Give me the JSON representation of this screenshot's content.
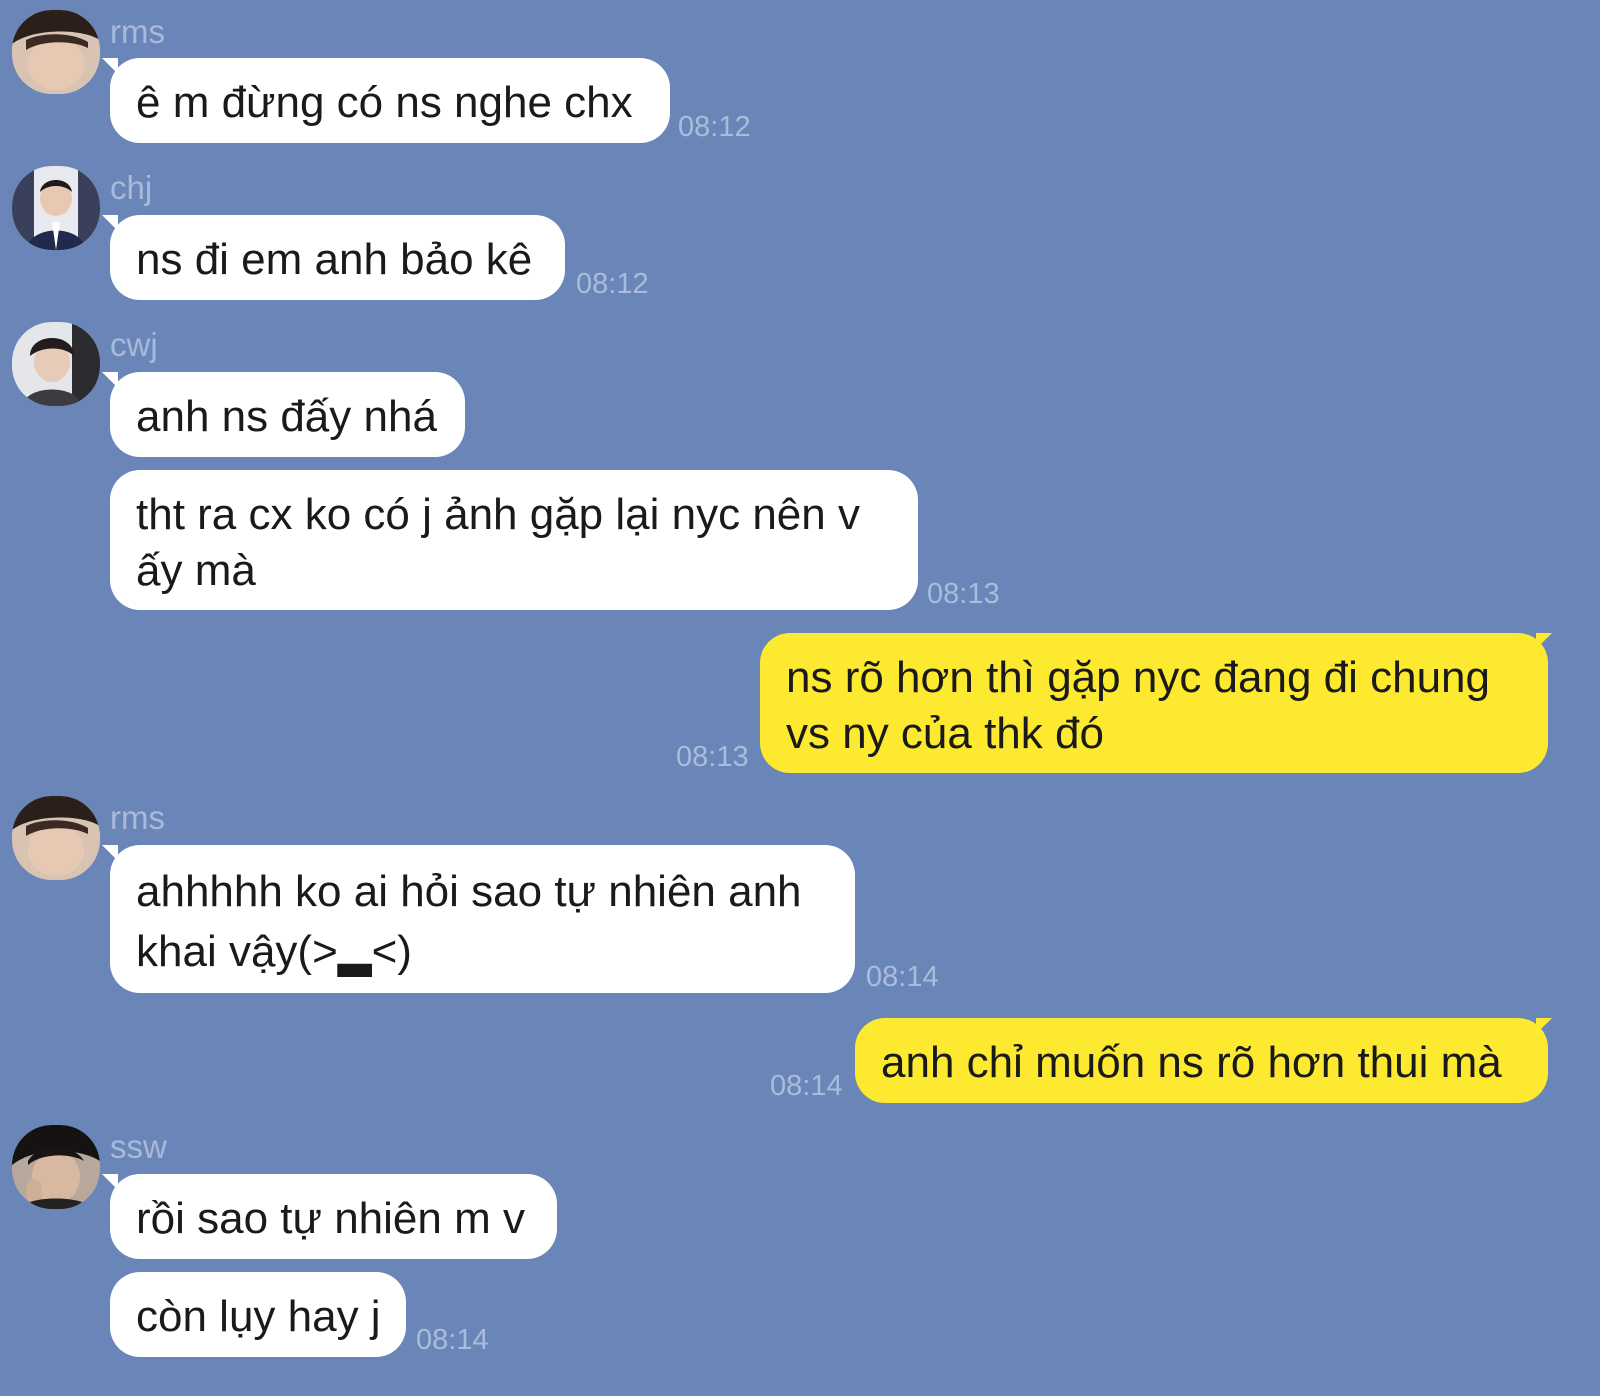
{
  "chat": {
    "messages": [
      {
        "sender": "rms",
        "text": "ê m đừng có ns nghe chx",
        "time": "08:12",
        "direction": "incoming",
        "avatar": "avatar-rms"
      },
      {
        "sender": "chj",
        "text": "ns đi em anh bảo kê",
        "time": "08:12",
        "direction": "incoming",
        "avatar": "avatar-chj"
      },
      {
        "sender": "cwj",
        "text": "anh ns đấy nhá",
        "time": "",
        "direction": "incoming",
        "avatar": "avatar-cwj"
      },
      {
        "sender": "",
        "lines": [
          "tht ra cx ko có j ảnh gặp lại nyc nên v",
          "ấy mà"
        ],
        "time": "08:13",
        "direction": "incoming"
      },
      {
        "sender": "",
        "lines": [
          "ns rõ hơn thì gặp nyc đang đi chung",
          "vs ny của thk đó"
        ],
        "time": "08:13",
        "direction": "outgoing"
      },
      {
        "sender": "rms",
        "lines": [
          "ahhhhh ko ai hỏi sao tự nhiên anh",
          "khai vậy(>▂<)"
        ],
        "time": "08:14",
        "direction": "incoming",
        "avatar": "avatar-rms"
      },
      {
        "sender": "",
        "text": "anh chỉ muốn ns rõ hơn thui mà",
        "time": "08:14",
        "direction": "outgoing"
      },
      {
        "sender": "ssw",
        "text": "rồi sao tự nhiên m v",
        "time": "",
        "direction": "incoming",
        "avatar": "avatar-ssw"
      },
      {
        "sender": "",
        "text": "còn lụy hay j",
        "time": "08:14",
        "direction": "incoming"
      }
    ]
  },
  "colors": {
    "background": "#6a86b8",
    "incoming_bubble": "#ffffff",
    "outgoing_bubble": "#fde92f",
    "meta_text": "#a9b9d9"
  }
}
